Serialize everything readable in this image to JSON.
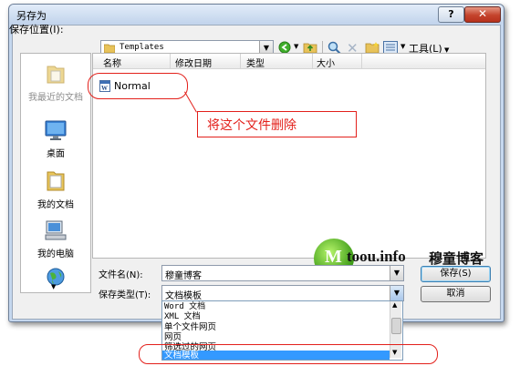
{
  "dialog": {
    "title": "另存为",
    "help_glyph": "?",
    "close_glyph": "✕"
  },
  "location": {
    "label": "保存位置(I):",
    "value": "Templates"
  },
  "toolbar": {
    "tools_label": "工具(L)",
    "icons": [
      "back-icon",
      "up-folder-icon",
      "search-web-icon",
      "delete-icon",
      "new-folder-icon",
      "views-icon"
    ]
  },
  "places": [
    {
      "label": "我最近的文档",
      "icon": "recent-docs-icon",
      "disabled": true
    },
    {
      "label": "桌面",
      "icon": "desktop-icon"
    },
    {
      "label": "我的文档",
      "icon": "my-documents-icon"
    },
    {
      "label": "我的电脑",
      "icon": "my-computer-icon"
    },
    {
      "label": "",
      "icon": "network-globe-icon"
    }
  ],
  "file_list": {
    "columns": [
      "名称",
      "修改日期",
      "类型",
      "大小"
    ],
    "items": [
      {
        "name": "Normal",
        "icon": "word-doc-icon"
      }
    ]
  },
  "annotation": {
    "text": "将这个文件删除",
    "color": "#e3201b"
  },
  "filename": {
    "label": "文件名(N):",
    "value": "穆童博客"
  },
  "filetype": {
    "label": "保存类型(T):",
    "value": "文档模板",
    "options": [
      "Word 文档",
      "XML 文档",
      "单个文件网页",
      "网页",
      "筛选过的网页",
      "文档模板"
    ],
    "selected_index": 5
  },
  "buttons": {
    "save": "保存(S)",
    "cancel": "取消"
  },
  "watermark": {
    "logo_m": "M",
    "site": "toou.info",
    "blog": "穆童博客"
  }
}
